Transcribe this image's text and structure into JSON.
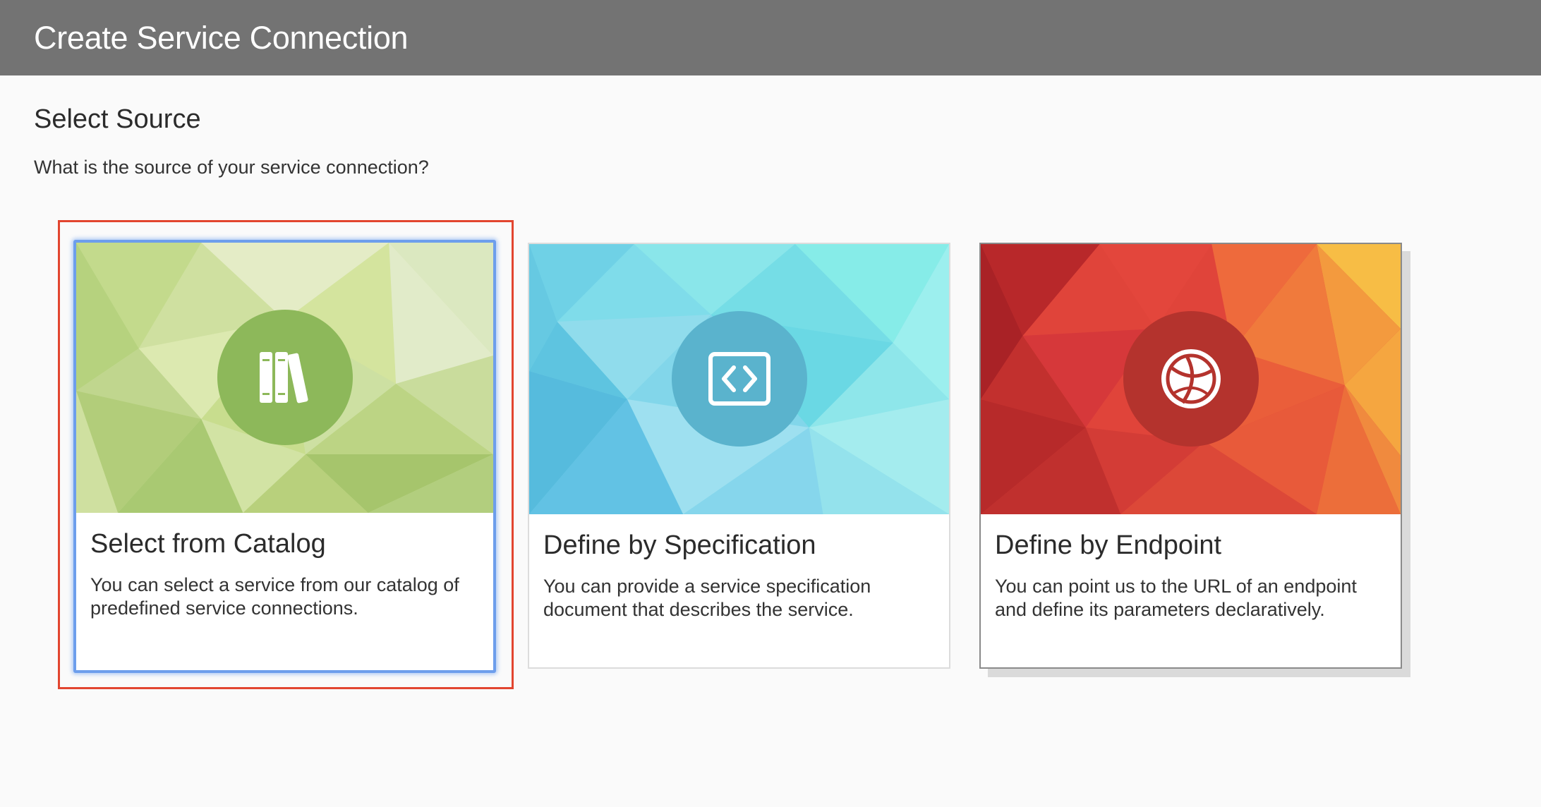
{
  "window": {
    "title": "Create Service Connection"
  },
  "section": {
    "title": "Select Source",
    "subtitle": "What is the source of your service connection?"
  },
  "cards": [
    {
      "title": "Select from Catalog",
      "description": "You can select a service from our catalog of predefined service connections.",
      "icon": "books-icon",
      "selected": true,
      "colors": {
        "circle": "#8db85a"
      }
    },
    {
      "title": "Define by Specification",
      "description": "You can provide a service specification document that describes the service.",
      "icon": "code-brackets-icon",
      "selected": false,
      "colors": {
        "circle": "#5ab3cd"
      }
    },
    {
      "title": "Define by Endpoint",
      "description": "You can point us to the URL of an endpoint and define its parameters declaratively.",
      "icon": "globe-endpoint-icon",
      "selected": false,
      "colors": {
        "circle": "#b4332d"
      }
    }
  ],
  "colors": {
    "titlebar": "#737373",
    "selection_focus": "#6d9eec",
    "highlight_outline": "#e2452f"
  }
}
